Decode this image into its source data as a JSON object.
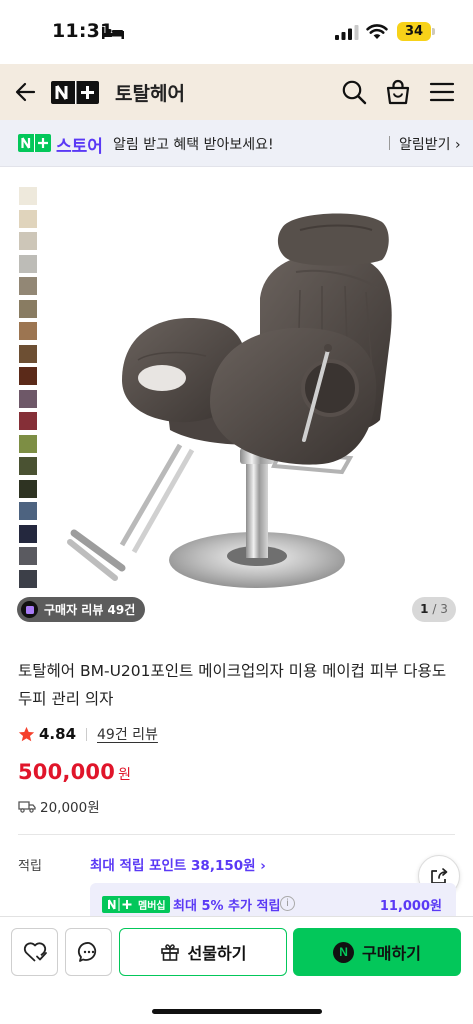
{
  "status_bar": {
    "time": "11:31",
    "battery": "34"
  },
  "nav": {
    "store_name": "토탈헤어",
    "icons": [
      "back-icon",
      "naver-plus-logo",
      "search-icon",
      "cart-icon",
      "menu-icon"
    ]
  },
  "notice": {
    "store_label": "스토어",
    "message": "알림 받고 혜택 받아보세요!",
    "action": "알림받기 ›"
  },
  "gallery": {
    "swatch_colors": [
      "#eee9dc",
      "#e0d4bc",
      "#cdc6b8",
      "#bdbcb7",
      "#928775",
      "#897c62",
      "#9c7551",
      "#6d4f33",
      "#5b2a19",
      "#6e5868",
      "#852f37",
      "#7d8e44",
      "#4a5232",
      "#2e3322",
      "#4d6380",
      "#24283e",
      "#5a5a60",
      "#3c3f48"
    ],
    "review_badge": "구매자 리뷰 49건",
    "page_current": "1",
    "page_total": "/ 3"
  },
  "product": {
    "title": "토탈헤어 BM-U201포인트 메이크업의자 미용 메이컵 피부 다용도 두피 관리 의자",
    "rating": "4.84",
    "review_count": "49건 리뷰",
    "price": "500,000",
    "price_unit": "원",
    "shipping": "20,000원"
  },
  "points": {
    "label": "적립",
    "max": "최대 적립 포인트 38,150원 ›",
    "membership_badge": "멤버십",
    "membership_text": "최대 5% 추가 적립",
    "membership_amount": "11,000원"
  },
  "bottom_bar": {
    "gift_label": "선물하기",
    "buy_label": "구매하기",
    "naver_mark": "N"
  },
  "colors": {
    "accent_green": "#03c75a",
    "price_red": "#e0152a",
    "point_purple": "#5a39f5",
    "nav_background": "#f3ebe0"
  }
}
